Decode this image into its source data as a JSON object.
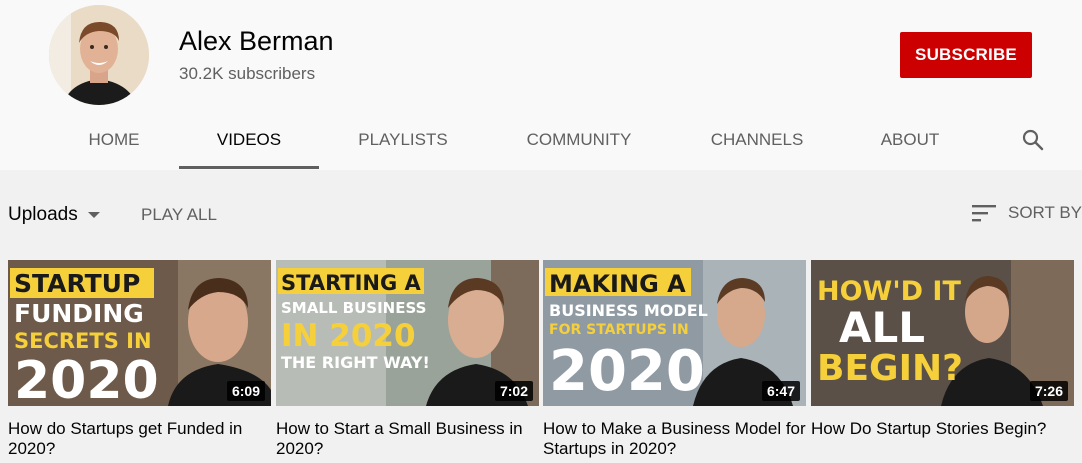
{
  "channel": {
    "name": "Alex Berman",
    "subscribers": "30.2K subscribers",
    "subscribe_label": "SUBSCRIBE"
  },
  "tabs": [
    {
      "label": "HOME",
      "active": false
    },
    {
      "label": "VIDEOS",
      "active": true
    },
    {
      "label": "PLAYLISTS",
      "active": false
    },
    {
      "label": "COMMUNITY",
      "active": false
    },
    {
      "label": "CHANNELS",
      "active": false
    },
    {
      "label": "ABOUT",
      "active": false
    }
  ],
  "search_icon": "search-icon",
  "toolbar": {
    "uploads_label": "Uploads",
    "play_all_label": "PLAY ALL",
    "sort_label": "SORT BY",
    "sort_icon": "sort-icon"
  },
  "videos": [
    {
      "title": "How do Startups get Funded in 2020?",
      "duration": "6:09",
      "thumb_lines": [
        "STARTUP",
        "FUNDING",
        "SECRETS IN",
        "2020"
      ]
    },
    {
      "title": "How to Start a Small Business in 2020?",
      "duration": "7:02",
      "thumb_lines": [
        "STARTING A",
        "SMALL BUSINESS",
        "IN 2020",
        "THE RIGHT WAY!"
      ]
    },
    {
      "title": "How to Make a Business Model for Startups in 2020?",
      "duration": "6:47",
      "thumb_lines": [
        "MAKING A",
        "BUSINESS MODEL",
        "FOR STARTUPS IN",
        "2020"
      ]
    },
    {
      "title": "How Do Startup Stories Begin?",
      "duration": "7:26",
      "thumb_lines": [
        "HOW'D IT",
        "ALL",
        "BEGIN?"
      ]
    }
  ],
  "colors": {
    "subscribe": "#cc0000",
    "thumb_yellow": "#f5d03b",
    "text_secondary": "#606060"
  }
}
